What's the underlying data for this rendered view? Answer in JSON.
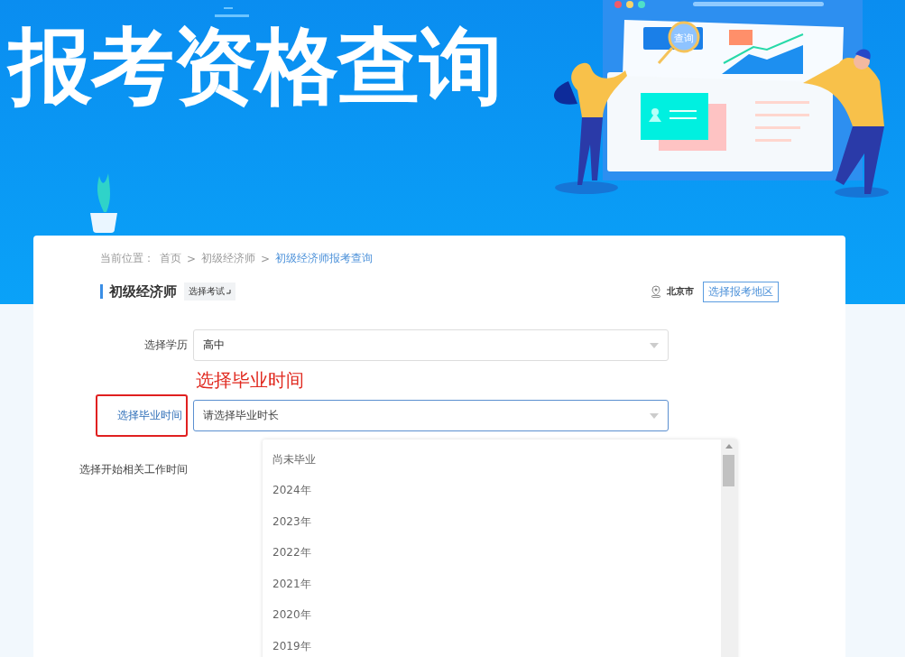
{
  "banner": {
    "title": "报考资格查询",
    "magnifier_label": "查询"
  },
  "breadcrumb": {
    "prefix": "当前位置：",
    "items": [
      {
        "label": "首页",
        "current": false
      },
      {
        "label": "初级经济师",
        "current": false
      },
      {
        "label": "初级经济师报考查询",
        "current": true
      }
    ],
    "separator": ">"
  },
  "header": {
    "title": "初级经济师",
    "exam_button": "选择考试",
    "city": "北京市",
    "region_button": "选择报考地区"
  },
  "annotation": "选择毕业时间",
  "form": {
    "fields": [
      {
        "label": "选择学历",
        "value": "高中",
        "focused": false,
        "highlighted": false
      },
      {
        "label": "选择毕业时间",
        "placeholder": "请选择毕业时长",
        "focused": true,
        "highlighted": true
      },
      {
        "label": "选择开始相关工作时间",
        "focused": false,
        "highlighted": false
      }
    ]
  },
  "dropdown": {
    "options": [
      "尚未毕业",
      "2024年",
      "2023年",
      "2022年",
      "2021年",
      "2020年",
      "2019年"
    ]
  }
}
